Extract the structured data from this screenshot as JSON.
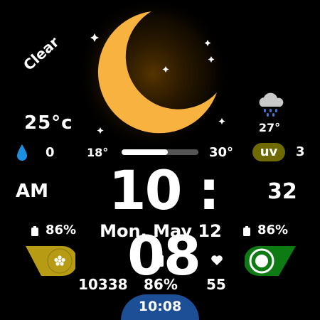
{
  "weather": {
    "condition": "Clear",
    "current_temp": "25°c",
    "precipitation": "0",
    "temp_min": "18°",
    "temp_max": "30°",
    "temp_range_fill": 0.6,
    "uv_label": "uv",
    "uv_index": "3",
    "forecast_temp": "27°",
    "forecast_icon": "cloud-rain-icon",
    "main_icon": "moon-icon"
  },
  "time": {
    "ampm": "AM",
    "hours_minutes": "10 : 08",
    "seconds": "32",
    "bottom_time": "10:08"
  },
  "date": {
    "label": "Mon, May 12"
  },
  "stats": {
    "battery_left": "86%",
    "battery_right": "86%",
    "steps": "10338",
    "battery_mid": "86%",
    "heart_rate": "55"
  },
  "colors": {
    "moon": "#f7b240",
    "uv_badge": "#6e6a00",
    "left_complication": "#b79b14",
    "right_complication": "#0d7a14",
    "bottom_pill": "#1c4f95"
  }
}
